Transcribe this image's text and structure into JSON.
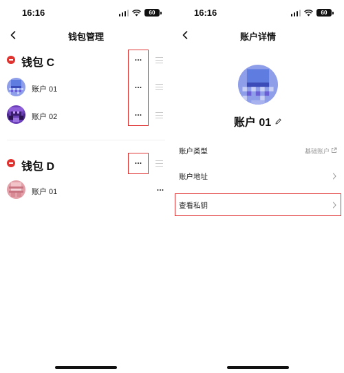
{
  "left_screen": {
    "status_time": "16:16",
    "battery": "60",
    "title": "钱包管理",
    "wallets": [
      {
        "name": "钱包 C",
        "more": "···",
        "accounts": [
          {
            "name": "账户 01",
            "more": "···"
          },
          {
            "name": "账户 02",
            "more": "···"
          }
        ]
      },
      {
        "name": "钱包 D",
        "more": "···",
        "accounts": [
          {
            "name": "账户 01",
            "more": "···"
          }
        ]
      }
    ]
  },
  "right_screen": {
    "status_time": "16:16",
    "battery": "60",
    "title": "账户详情",
    "account_name": "账户 01",
    "rows": [
      {
        "label": "账户类型",
        "value": "基础账户"
      },
      {
        "label": "账户地址",
        "value": ""
      },
      {
        "label": "查看私钥",
        "value": ""
      }
    ]
  },
  "colors": {
    "accent_red": "#e03131",
    "delete_red": "#e0322e"
  },
  "icons": [
    "back-chevron-icon",
    "minus-circle-icon",
    "more-dots-icon",
    "drag-handle-icon",
    "edit-pencil-icon",
    "external-link-icon",
    "chevron-right-icon"
  ]
}
